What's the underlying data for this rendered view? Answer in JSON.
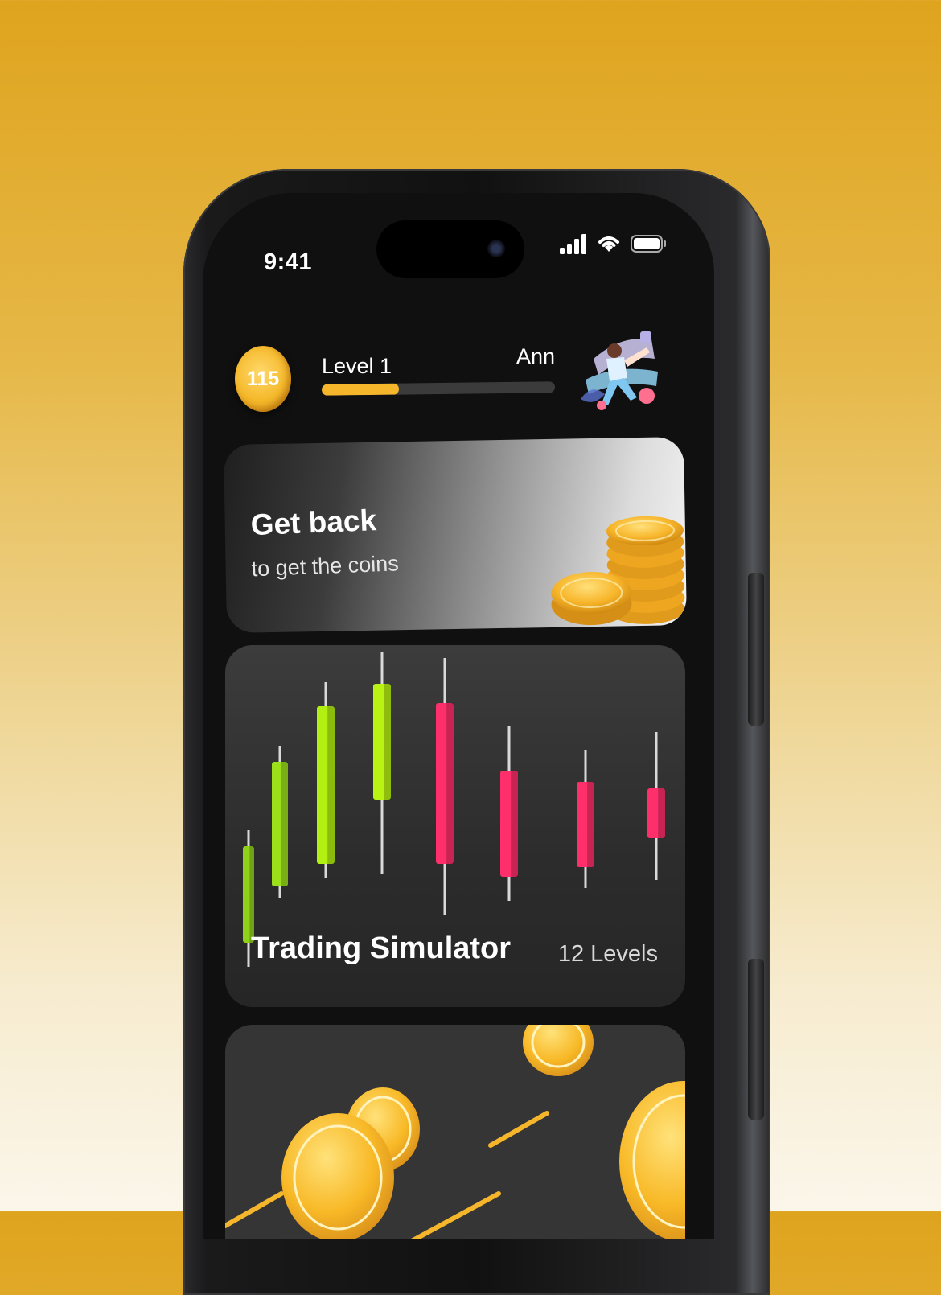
{
  "status_bar": {
    "time": "9:41"
  },
  "header": {
    "coins": "115",
    "level_label": "Level 1",
    "user_name": "Ann",
    "level_progress": 0.33
  },
  "promo_card": {
    "title": "Get back",
    "subtitle": "to get the coins"
  },
  "trading_card": {
    "title": "Trading Simulator",
    "levels": "12 Levels",
    "candles": [
      {
        "color": "#8fd11a"
      },
      {
        "color": "#9ce01a"
      },
      {
        "color": "#b2f011"
      },
      {
        "color": "#b8f313"
      },
      {
        "color": "#ff2f6c"
      },
      {
        "color": "#ff2f6c"
      },
      {
        "color": "#ff2f6c"
      },
      {
        "color": "#ff2f6c"
      }
    ]
  },
  "colors": {
    "accent": "#f6b62b",
    "bull": "#b2f011",
    "bear": "#ff2f6c"
  },
  "icons": [
    "cellular-signal-icon",
    "wifi-icon",
    "battery-icon",
    "coin-icon",
    "avatar-illustration"
  ]
}
